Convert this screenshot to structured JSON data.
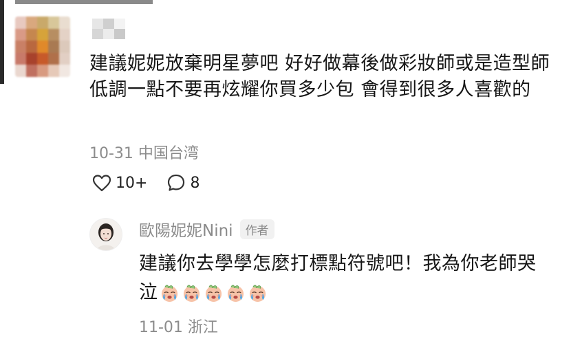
{
  "comment": {
    "text": "建議妮妮放棄明星夢吧 好好做幕後做彩妝師或是造型師 低調一點不要再炫耀你買多少包 會得到很多人喜歡的",
    "meta": "10-31 中国台湾",
    "likes": "10+",
    "replies": "8"
  },
  "reply": {
    "author": "歐陽妮妮Nini",
    "badge": "作者",
    "text": "建議你去學學怎麼打標點符號吧！我為你老師哭泣",
    "emoji_count": 5,
    "meta": "11-01 浙江"
  },
  "icons": {
    "like": "heart-icon",
    "reply": "speech-bubble-icon",
    "emoji": "crying-face-emoji"
  },
  "colors": {
    "meta_text": "#8c8c8c",
    "body_text": "#161616",
    "badge_bg": "#f1f1f1"
  }
}
